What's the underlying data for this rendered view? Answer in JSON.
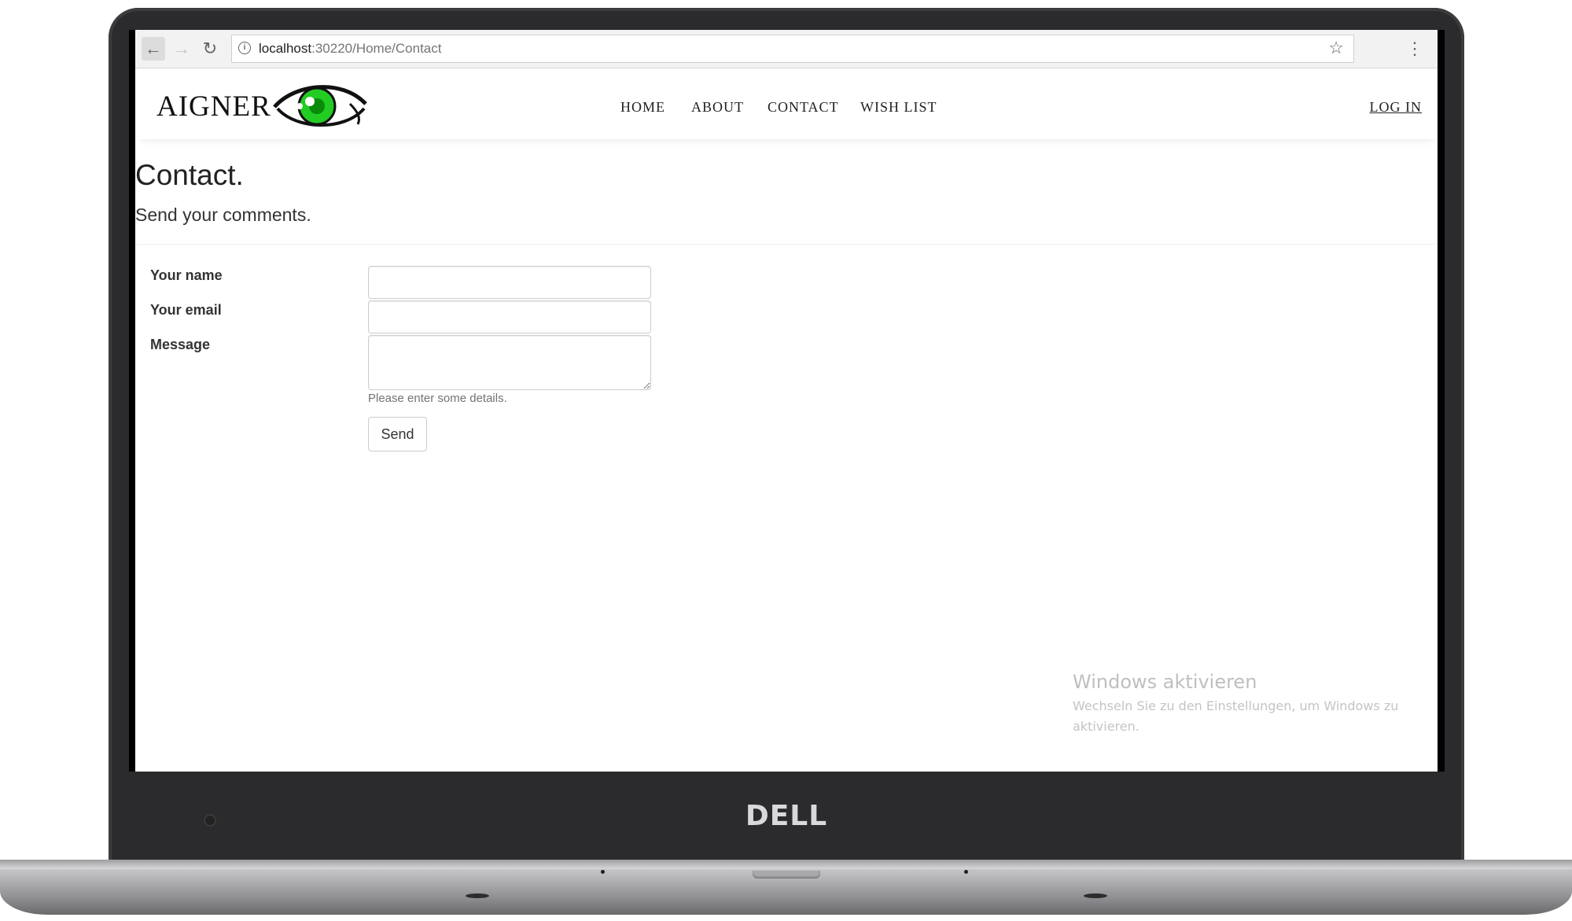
{
  "browser": {
    "url_host": "localhost",
    "url_path": ":30220/Home/Contact",
    "back_icon": "back-arrow-icon",
    "forward_icon": "forward-arrow-icon",
    "reload_icon": "reload-icon"
  },
  "site": {
    "brand": "AIGNER",
    "brand_color": "#22cc22",
    "nav": [
      "HOME",
      "ABOUT",
      "CONTACT",
      "WISH LIST"
    ],
    "login": "LOG IN"
  },
  "page": {
    "title": "Contact.",
    "subtitle": "Send your comments."
  },
  "form": {
    "name_label": "Your name",
    "email_label": "Your email",
    "message_label": "Message",
    "name_value": "",
    "email_value": "",
    "message_value": "",
    "help_text": "Please enter some details.",
    "send_label": "Send"
  },
  "windows_notice": {
    "title": "Windows aktivieren",
    "subtitle": "Wechseln Sie zu den Einstellungen, um Windows zu aktivieren."
  },
  "device": {
    "logo": "DELL"
  }
}
